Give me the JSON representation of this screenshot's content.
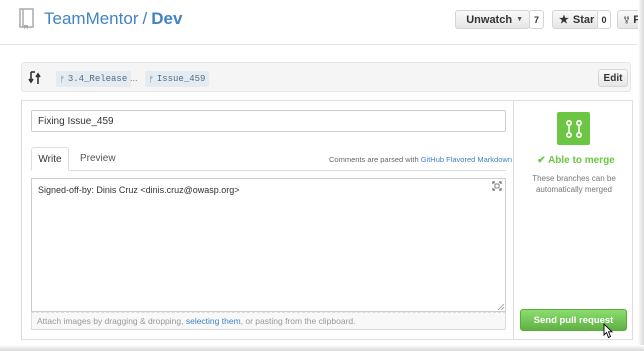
{
  "header": {
    "owner": "TeamMentor",
    "separator": "/",
    "repo": "Dev",
    "unwatch_label": "Unwatch",
    "unwatch_count": "7",
    "star_label": "Star",
    "star_count": "0",
    "fork_label": "F"
  },
  "compare": {
    "base_branch": "3.4_Release",
    "ellipsis": "...",
    "head_branch": "Issue_459",
    "edit_label": "Edit"
  },
  "form": {
    "title_value": "Fixing Issue_459",
    "tab_write": "Write",
    "tab_preview": "Preview",
    "markdown_note_prefix": "Comments are parsed with ",
    "markdown_link": "GitHub Flavored Markdown",
    "body_text": "Signed-off-by: Dinis Cruz <dinis.cruz@owasp.org>",
    "attach_prefix": "Attach images by dragging & dropping, ",
    "attach_link": "selecting them",
    "attach_suffix": ", or pasting from the clipboard."
  },
  "merge": {
    "status": "Able to merge",
    "description": "These branches can be automatically merged",
    "send_button": "Send pull request"
  },
  "colors": {
    "link": "#4183c4",
    "merge_green": "#6cc644",
    "send_button": "#60b044"
  },
  "icons": [
    "repo-icon",
    "eye-icon",
    "star-icon",
    "fork-icon",
    "compare-icon",
    "branch-icon",
    "check-icon",
    "merge-icon",
    "fullscreen-icon",
    "resize-icon",
    "mouse-cursor-icon"
  ]
}
